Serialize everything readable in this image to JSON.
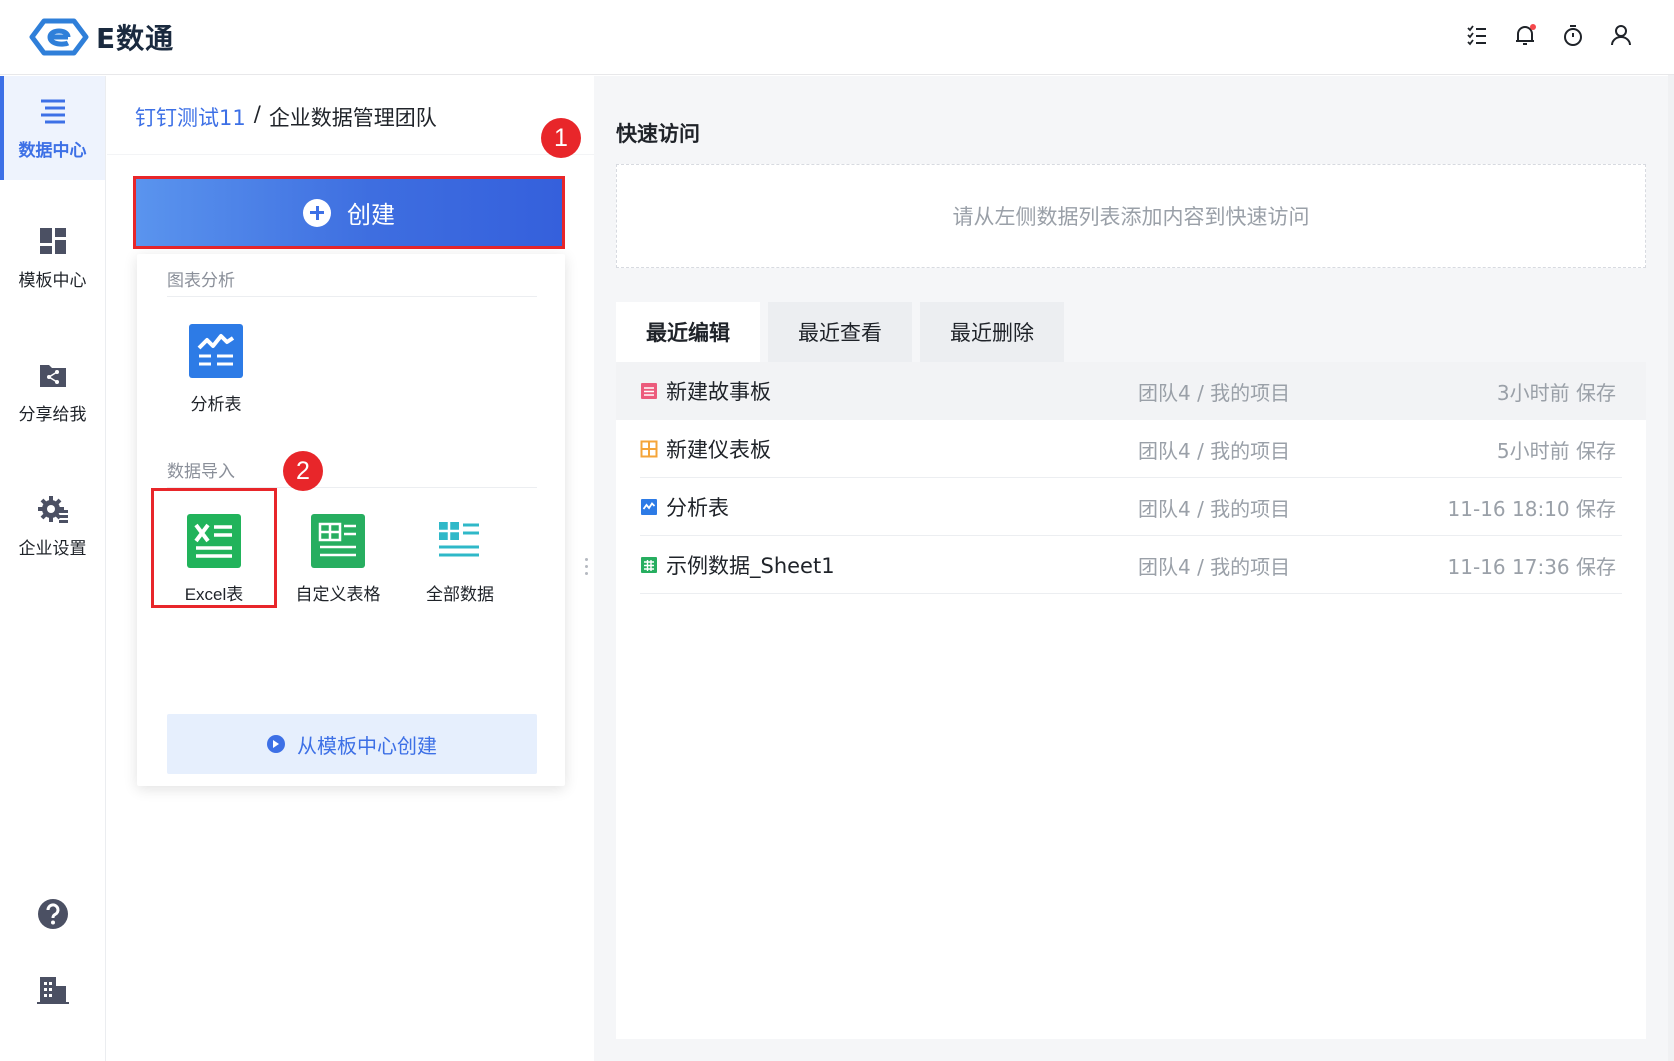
{
  "app": {
    "logo_text": "E数通",
    "brand_color": "#3d70e6"
  },
  "top_icons": [
    "checklist-icon",
    "bell-icon",
    "timer-icon",
    "user-icon"
  ],
  "nav": {
    "items": [
      {
        "label": "数据中心",
        "icon": "data-center-icon",
        "active": true
      },
      {
        "label": "模板中心",
        "icon": "template-icon",
        "active": false
      },
      {
        "label": "分享给我",
        "icon": "share-icon",
        "active": false
      },
      {
        "label": "企业设置",
        "icon": "settings-gear-icon",
        "active": false
      }
    ],
    "bottom": [
      "help-icon",
      "building-icon"
    ]
  },
  "breadcrumb": {
    "link": "钉钉测试11",
    "sep": "/",
    "current": "企业数据管理团队"
  },
  "create": {
    "label": "创建"
  },
  "dropdown": {
    "section_chart": "图表分析",
    "chart_tiles": [
      {
        "label": "分析表",
        "icon": "analysis-table-icon"
      }
    ],
    "section_import": "数据导入",
    "import_tiles": [
      {
        "label": "Excel表",
        "icon": "excel-icon"
      },
      {
        "label": "自定义表格",
        "icon": "custom-table-icon"
      },
      {
        "label": "全部数据",
        "icon": "all-data-icon"
      }
    ],
    "template_button": "从模板中心创建"
  },
  "badges": {
    "first": "1",
    "second": "2"
  },
  "quick_access": {
    "title": "快速访问",
    "placeholder": "请从左侧数据列表添加内容到快速访问"
  },
  "tabs": [
    {
      "label": "最近编辑",
      "active": true
    },
    {
      "label": "最近查看",
      "active": false
    },
    {
      "label": "最近删除",
      "active": false
    }
  ],
  "recent": [
    {
      "name": "新建故事板",
      "path": "团队4 / 我的项目",
      "time": "3小时前 保存",
      "icon": "storyboard-icon",
      "color": "#ec5b7c"
    },
    {
      "name": "新建仪表板",
      "path": "团队4 / 我的项目",
      "time": "5小时前 保存",
      "icon": "dashboard-icon",
      "color": "#f5a53a"
    },
    {
      "name": "分析表",
      "path": "团队4 / 我的项目",
      "time": "11-16 18:10 保存",
      "icon": "analysis-table-icon",
      "color": "#2d7be6"
    },
    {
      "name": "示例数据_Sheet1",
      "path": "团队4 / 我的项目",
      "time": "11-16 17:36 保存",
      "icon": "sheet-icon",
      "color": "#27ae60"
    }
  ]
}
